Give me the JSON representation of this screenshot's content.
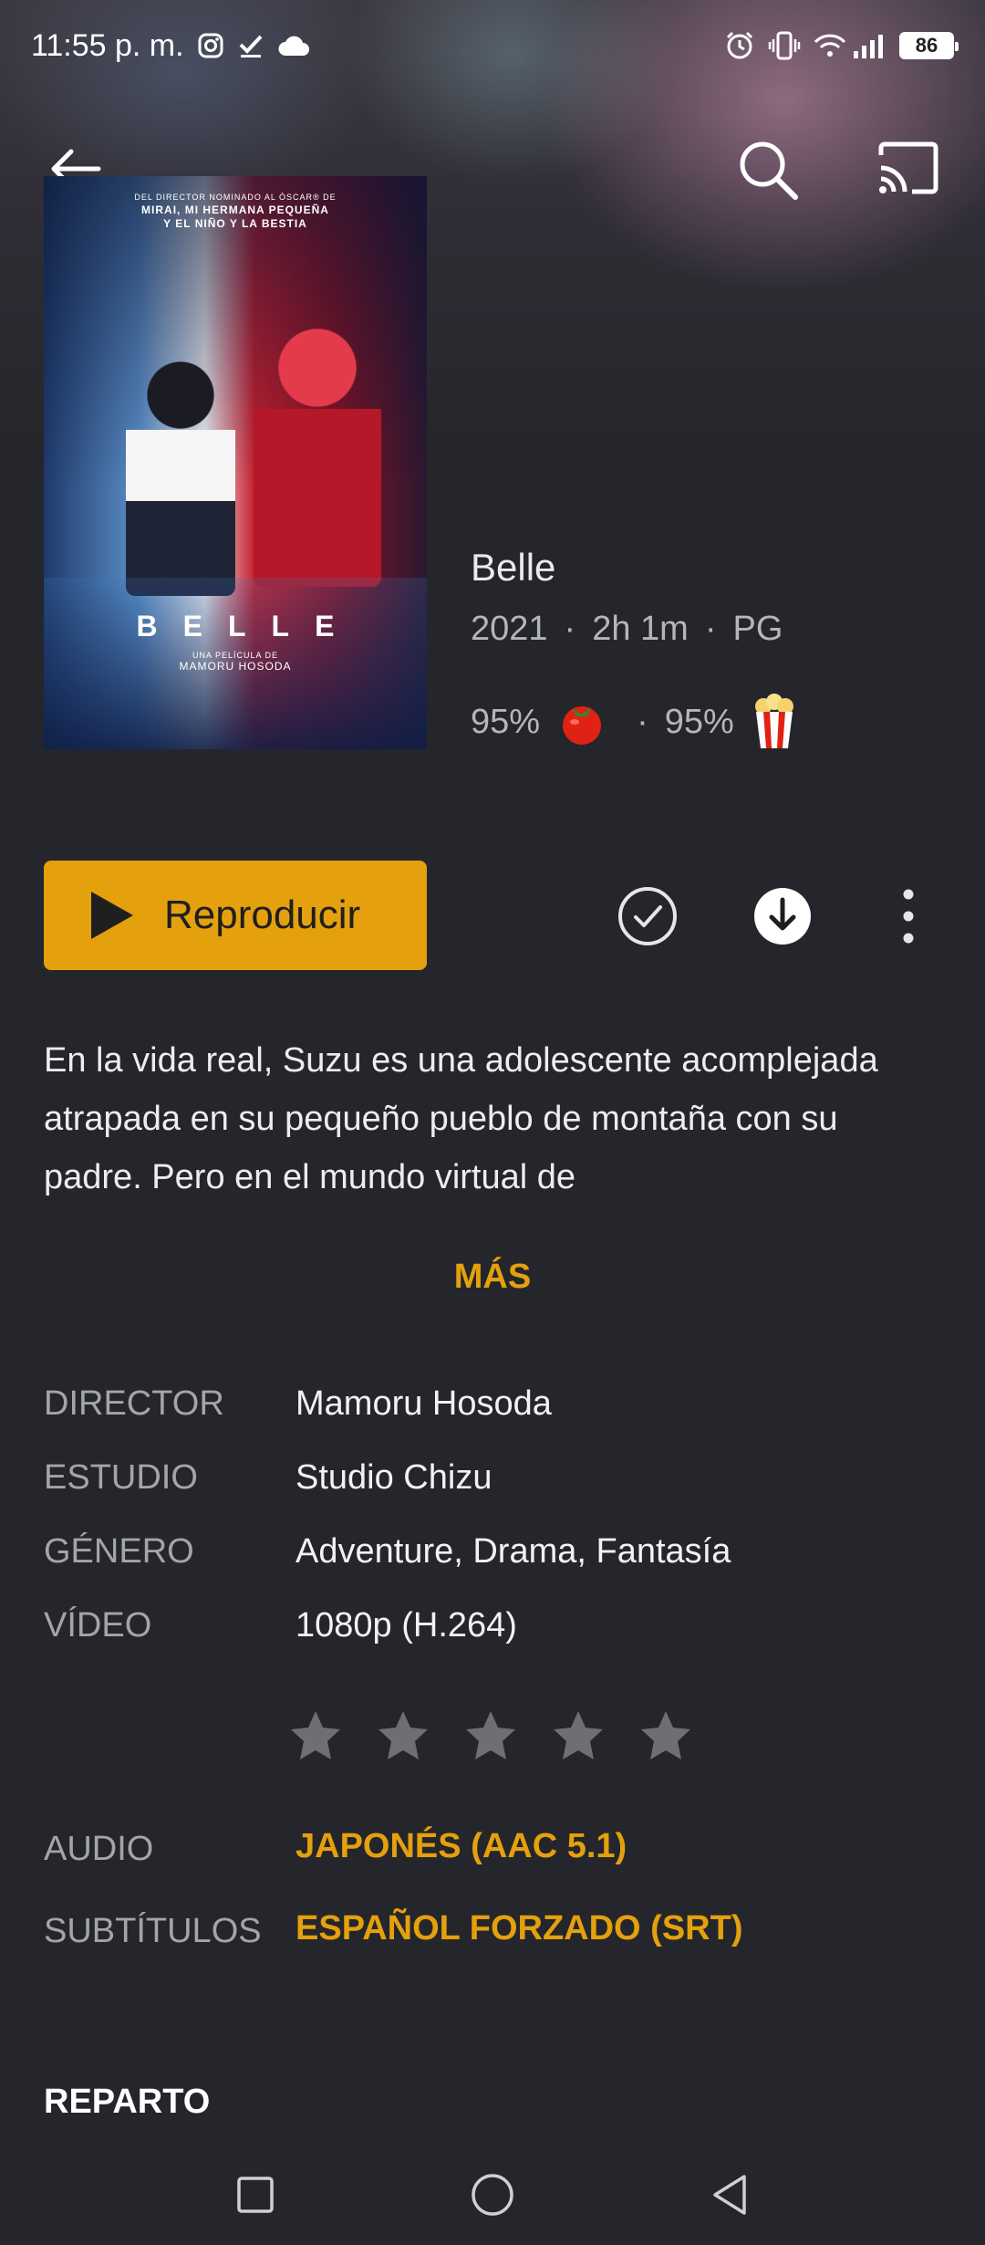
{
  "status_bar": {
    "time": "11:55 p. m.",
    "battery": "86"
  },
  "movie": {
    "title": "Belle",
    "year": "2021",
    "duration": "2h 1m",
    "rating": "PG",
    "critic_score": "95%",
    "audience_score": "95%"
  },
  "poster": {
    "top_text_1": "DEL DIRECTOR NOMINADO AL ÓSCAR® DE",
    "top_text_2": "MIRAI, MI HERMANA PEQUEÑA",
    "top_text_3": "Y EL NIÑO Y LA BESTIA",
    "title": "BELLE",
    "credit_1": "UNA PELÍCULA DE",
    "credit_2": "MAMORU HOSODA"
  },
  "actions": {
    "play_label": "Reproducir"
  },
  "synopsis": "En la vida real, Suzu es una adolescente acomplejada atrapada en su pequeño pueblo de montaña con su padre. Pero en el mundo virtual de",
  "more_label": "MÁS",
  "details": {
    "director_label": "DIRECTOR",
    "director_value": "Mamoru Hosoda",
    "studio_label": "ESTUDIO",
    "studio_value": "Studio Chizu",
    "genre_label": "GÉNERO",
    "genre_value": "Adventure, Drama, Fantasía",
    "video_label": "VÍDEO",
    "video_value": "1080p (H.264)",
    "audio_label": "AUDIO",
    "audio_value": "JAPONÉS (AAC 5.1)",
    "subtitles_label": "SUBTÍTULOS",
    "subtitles_value": "ESPAÑOL FORZADO (SRT)"
  },
  "user_rating": {
    "stars_filled": 0,
    "stars_total": 5
  },
  "cast_heading": "REPARTO",
  "colors": {
    "accent": "#e5a00d",
    "background": "#24262b",
    "muted_text": "#a3a5a9"
  },
  "icons": {
    "back": "arrow-left-icon",
    "search": "search-icon",
    "cast": "cast-icon",
    "watched": "check-circle-icon",
    "download": "download-icon",
    "more": "more-vertical-icon",
    "tomato": "tomato-icon",
    "popcorn": "popcorn-icon"
  }
}
